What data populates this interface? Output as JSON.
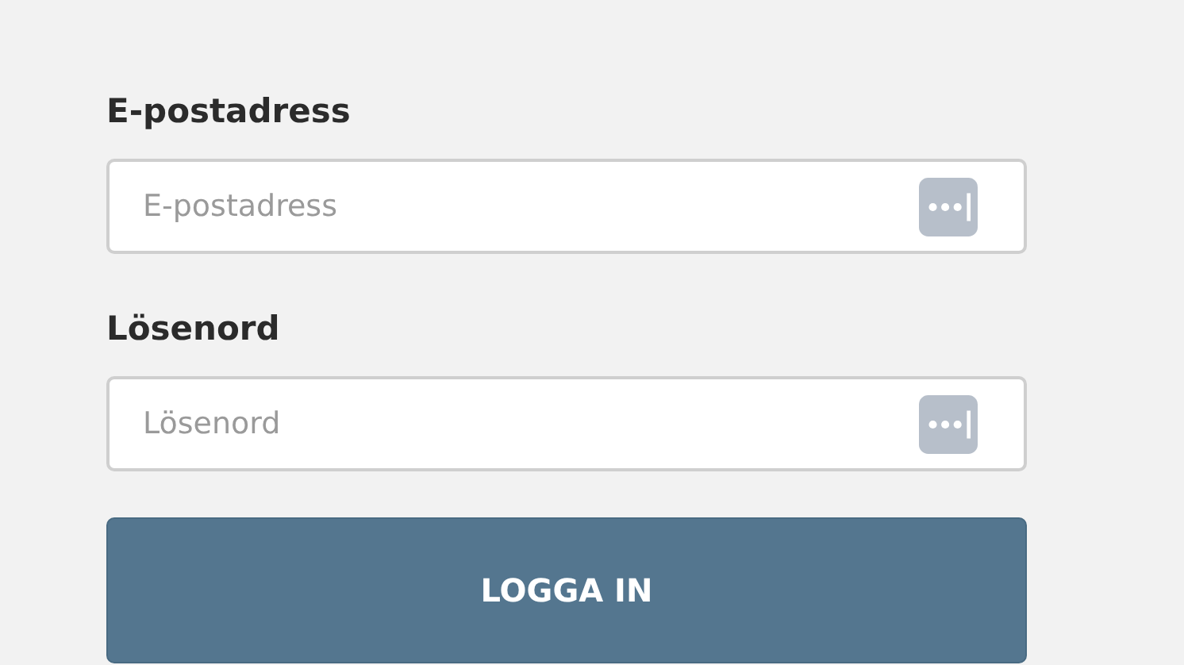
{
  "fields": [
    {
      "label": "E-postadress",
      "placeholder": "E-postadress"
    },
    {
      "label": "Lösenord",
      "placeholder": "Lösenord"
    }
  ],
  "button": {
    "label": "LOGGA IN"
  }
}
